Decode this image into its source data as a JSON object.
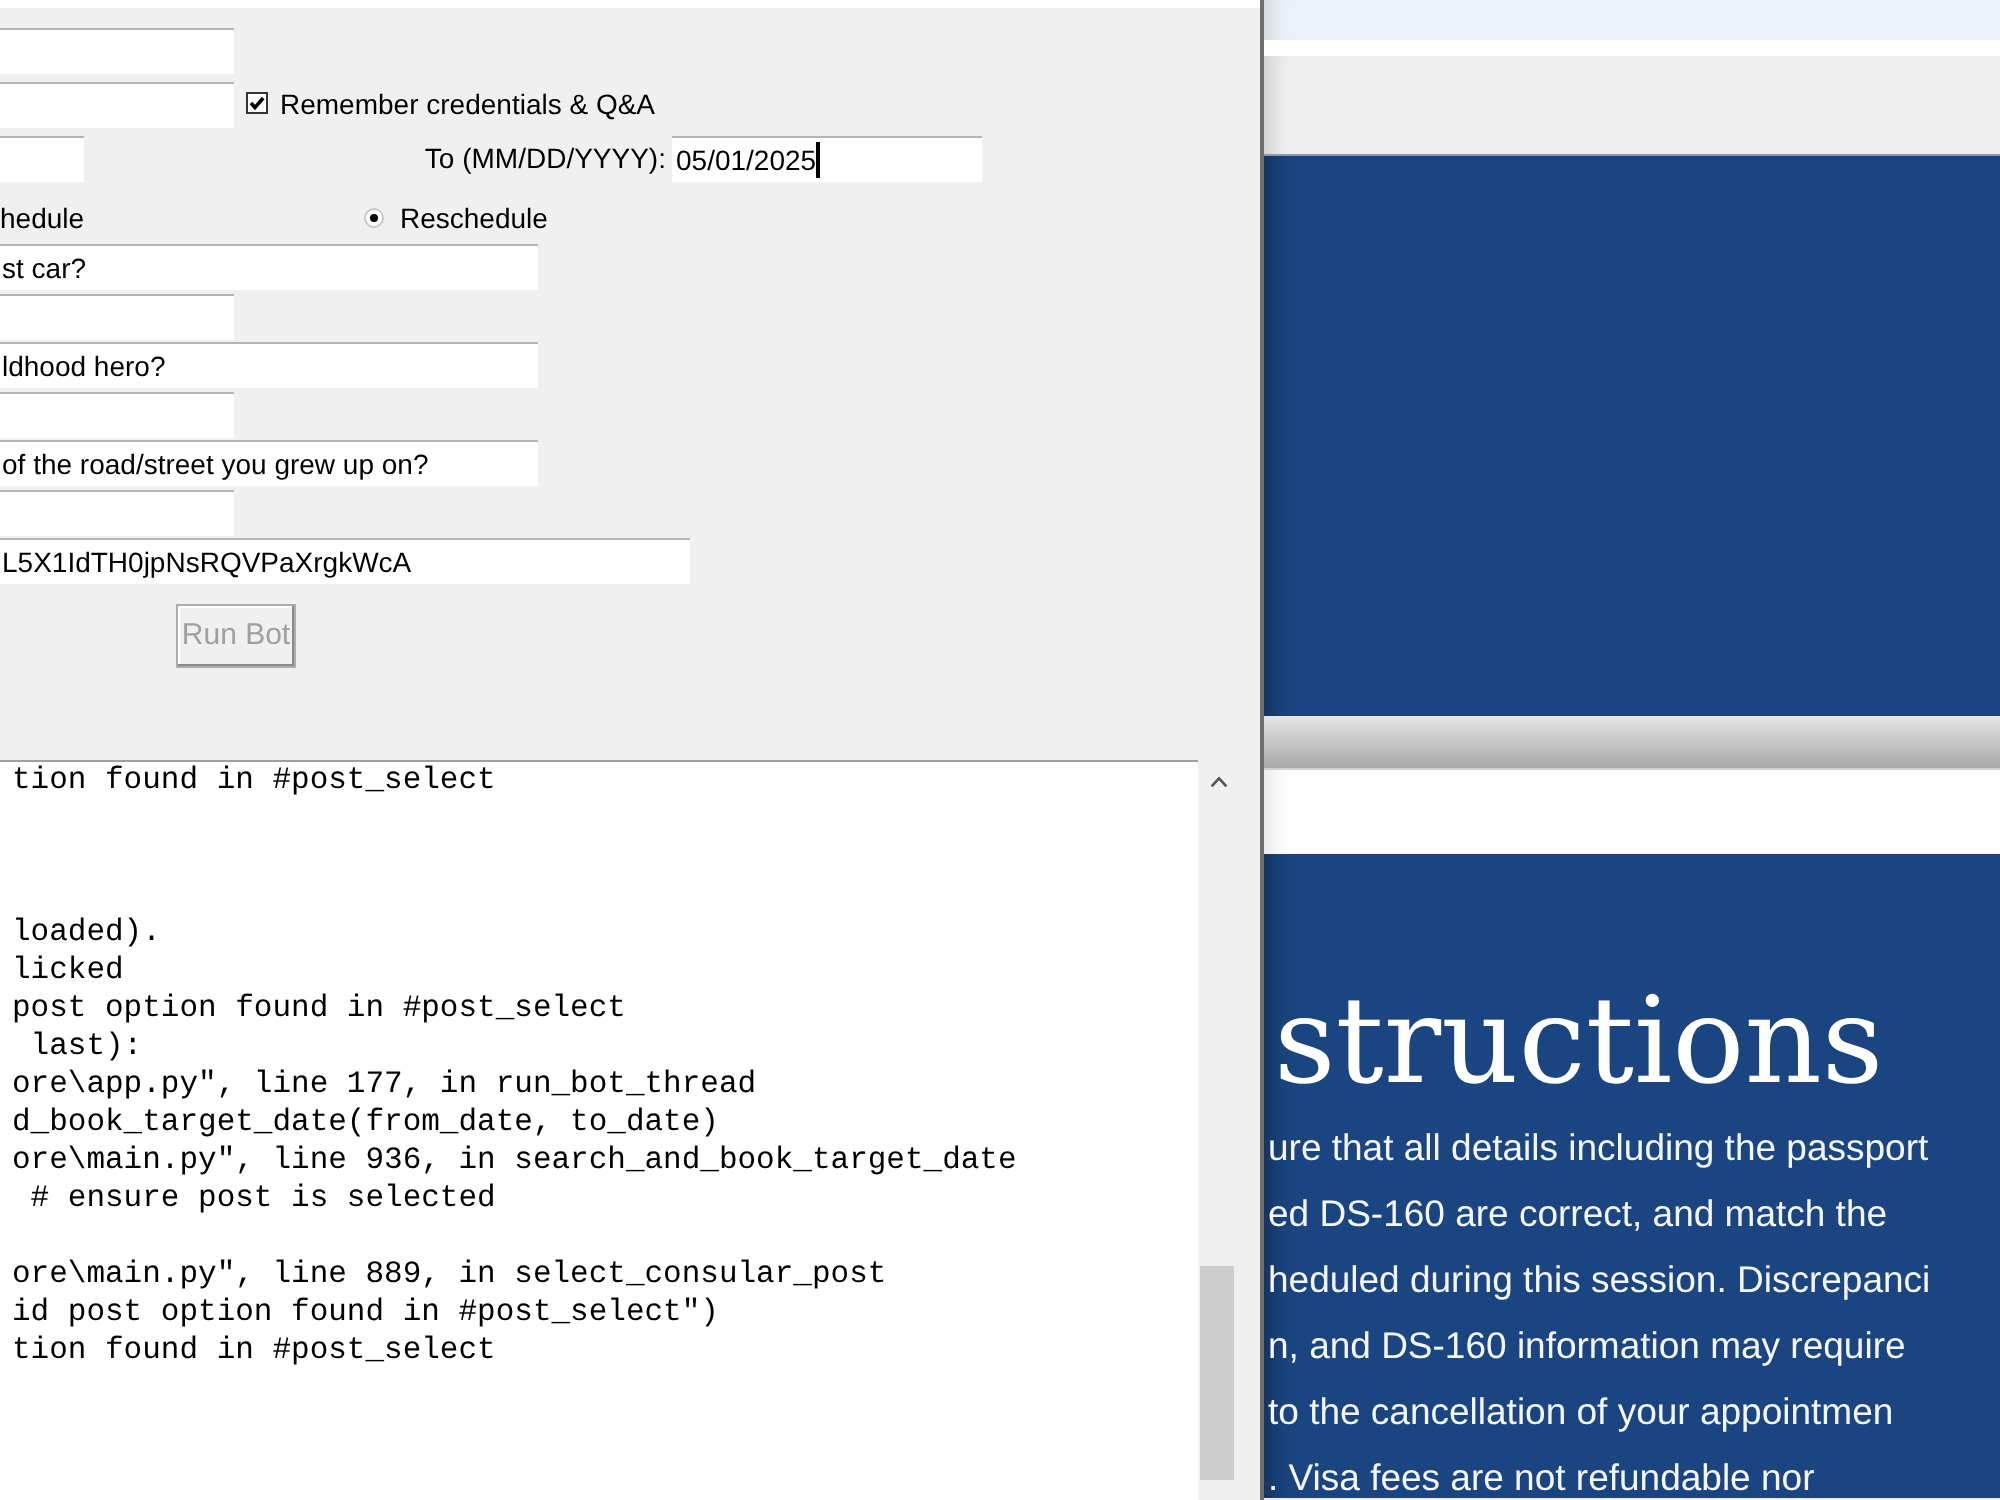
{
  "form": {
    "rows": [
      {
        "kind": "entry"
      },
      {
        "kind": "entry_with_checkbox",
        "checkbox": {
          "label": "Remember credentials & Q&A",
          "checked": true
        }
      },
      {
        "kind": "date_range",
        "to_label": "To (MM/DD/YYYY):",
        "to_value": "05/01/2025",
        "to_focused": true
      },
      {
        "kind": "mode",
        "first_label": "hedule",
        "second": {
          "label": "Reschedule",
          "selected": true
        }
      },
      {
        "kind": "question",
        "value": "st car?"
      },
      {
        "kind": "answer"
      },
      {
        "kind": "question",
        "value": "ldhood hero?"
      },
      {
        "kind": "answer"
      },
      {
        "kind": "question",
        "value": "of the road/street you grew up on?"
      },
      {
        "kind": "answer"
      },
      {
        "kind": "token",
        "value": "L5X1IdTH0jpNsRQVPaXrgkWcA"
      }
    ],
    "run_button": {
      "label": "Run Bot",
      "disabled": true
    }
  },
  "log": {
    "lines": [
      {
        "kind": "text",
        "text": "tion found in #post_select"
      },
      {
        "kind": "blank"
      },
      {
        "kind": "blank"
      },
      {
        "kind": "blank"
      },
      {
        "kind": "text",
        "text": "loaded)."
      },
      {
        "kind": "text",
        "text": "licked"
      },
      {
        "kind": "text",
        "text": "post option found in #post_select"
      },
      {
        "kind": "text",
        "text": " last):"
      },
      {
        "kind": "text",
        "text": "ore\\app.py\", line 177, in run_bot_thread"
      },
      {
        "kind": "text",
        "text": "d_book_target_date(from_date, to_date)"
      },
      {
        "kind": "text",
        "text": "ore\\main.py\", line 936, in search_and_book_target_date"
      },
      {
        "kind": "text",
        "text": " # ensure post is selected"
      },
      {
        "kind": "blank"
      },
      {
        "kind": "text",
        "text": "ore\\main.py\", line 889, in select_consular_post"
      },
      {
        "kind": "text",
        "text": "id post option found in #post_select\")"
      },
      {
        "kind": "text",
        "text": "tion found in #post_select"
      }
    ]
  },
  "browser": {
    "heading": "structions",
    "paragraph_lines": [
      "ure that all details including the passport",
      "ed DS-160 are correct, and match the",
      "heduled during this session. Discrepanci",
      "n, and DS-160 information may require",
      "to the cancellation of your appointmen",
      ". Visa fees are not refundable nor"
    ]
  }
}
